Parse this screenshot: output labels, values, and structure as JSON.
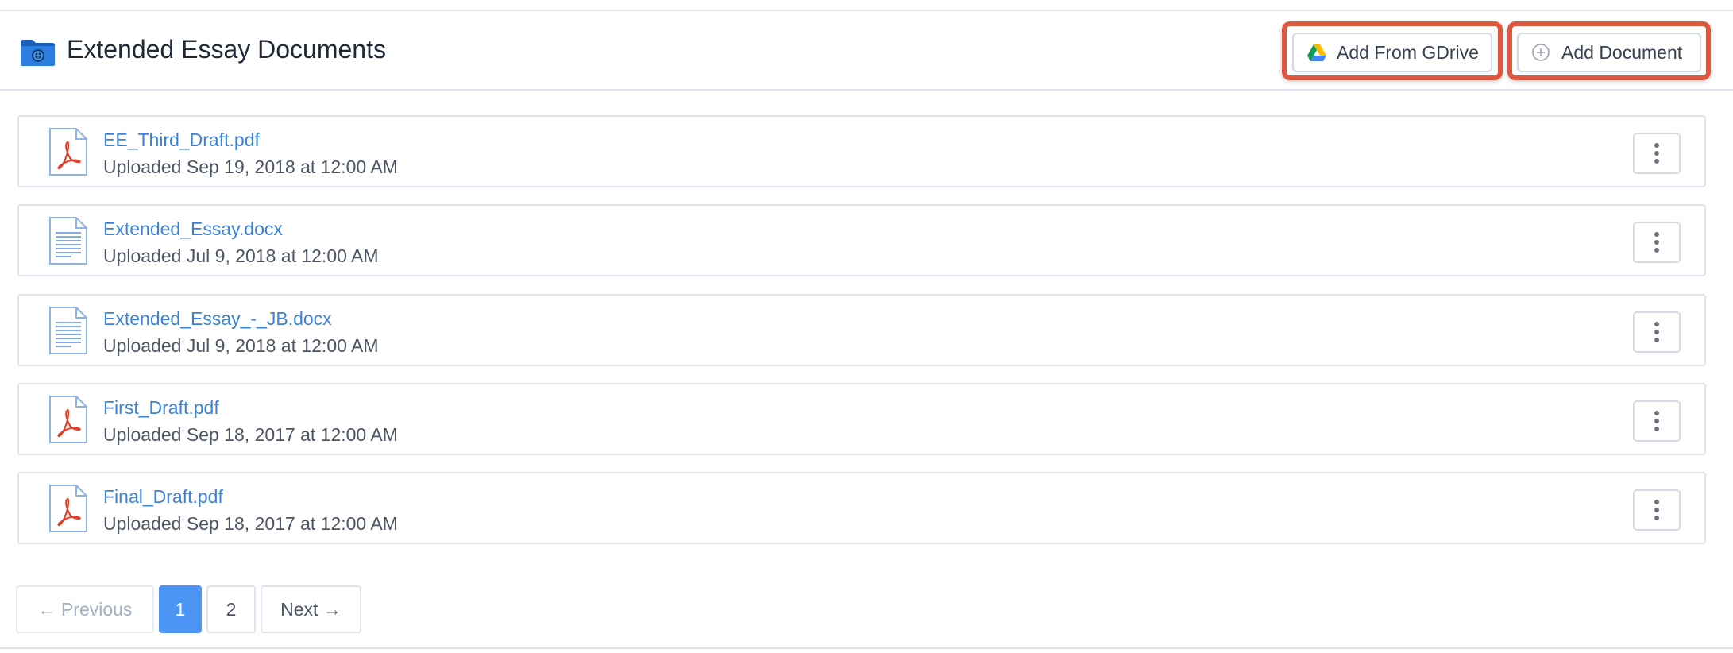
{
  "header": {
    "title": "Extended Essay Documents",
    "folder_icon": "folder-icon"
  },
  "actions": {
    "gdrive_label": "Add From GDrive",
    "gdrive_icon": "google-drive-icon",
    "add_document_label": "Add Document",
    "add_document_icon": "plus-circle-icon",
    "highlight_color": "#e0573f"
  },
  "documents": [
    {
      "name": "EE_Third_Draft.pdf",
      "uploaded": "Uploaded Sep 19, 2018 at 12:00 AM",
      "type": "pdf"
    },
    {
      "name": "Extended_Essay.docx",
      "uploaded": "Uploaded Jul 9, 2018 at 12:00 AM",
      "type": "docx"
    },
    {
      "name": "Extended_Essay_-_JB.docx",
      "uploaded": "Uploaded Jul 9, 2018 at 12:00 AM",
      "type": "docx"
    },
    {
      "name": "First_Draft.pdf",
      "uploaded": "Uploaded Sep 18, 2017 at 12:00 AM",
      "type": "pdf"
    },
    {
      "name": "Final_Draft.pdf",
      "uploaded": "Uploaded Sep 18, 2017 at 12:00 AM",
      "type": "pdf"
    }
  ],
  "pagination": {
    "previous_label": "← Previous",
    "pages": [
      "1",
      "2"
    ],
    "current_page": "1",
    "next_label": "Next →"
  },
  "colors": {
    "link": "#3b82d6",
    "active_page": "#4c95f4",
    "pdf_red": "#e0402a",
    "doc_blue": "#5b8fd9"
  }
}
